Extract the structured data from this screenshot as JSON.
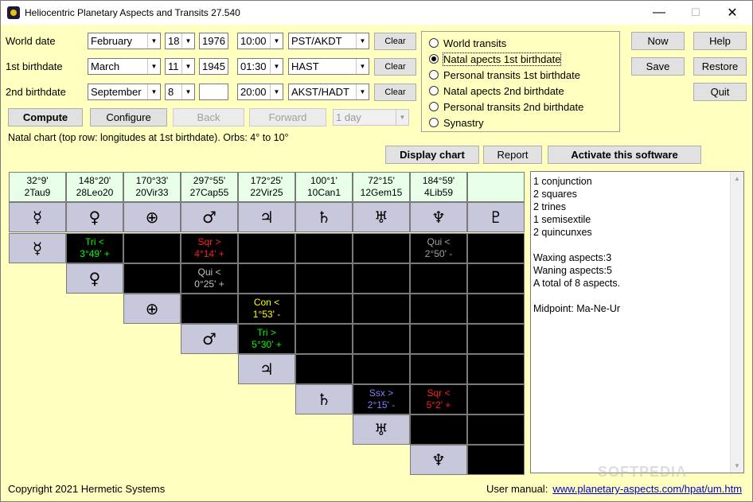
{
  "window": {
    "title": "Heliocentric Planetary Aspects and Transits 27.540"
  },
  "rows": [
    {
      "label": "World date",
      "month": "February",
      "day": "18",
      "year": "1976",
      "time": "10:00",
      "zone": "PST/AKDT",
      "clear": "Clear"
    },
    {
      "label": "1st birthdate",
      "month": "March",
      "day": "11",
      "year": "1945",
      "time": "01:30",
      "zone": "HAST",
      "clear": "Clear"
    },
    {
      "label": "2nd birthdate",
      "month": "September",
      "day": "8",
      "year": "",
      "time": "20:00",
      "zone": "AKST/HADT",
      "clear": "Clear"
    }
  ],
  "buttons": {
    "compute": "Compute",
    "configure": "Configure",
    "back": "Back",
    "forward": "Forward",
    "step": "1 day",
    "now": "Now",
    "help": "Help",
    "save": "Save",
    "restore": "Restore",
    "quit": "Quit",
    "display_chart": "Display chart",
    "report": "Report",
    "activate": "Activate this software"
  },
  "modes": [
    {
      "label": "World transits",
      "selected": false
    },
    {
      "label": "Natal apects 1st birthdate",
      "selected": true
    },
    {
      "label": "Personal transits 1st birthdate",
      "selected": false
    },
    {
      "label": "Natal apects 2nd birthdate",
      "selected": false
    },
    {
      "label": "Personal transits 2nd birthdate",
      "selected": false
    },
    {
      "label": "Synastry",
      "selected": false
    }
  ],
  "status": "Natal chart (top row: longitudes at 1st birthdate).  Orbs: 4° to 10°",
  "headers": [
    {
      "deg": "32°9'",
      "sign": "2Tau9"
    },
    {
      "deg": "148°20'",
      "sign": "28Leo20"
    },
    {
      "deg": "170°33'",
      "sign": "20Vir33"
    },
    {
      "deg": "297°55'",
      "sign": "27Cap55"
    },
    {
      "deg": "172°25'",
      "sign": "22Vir25"
    },
    {
      "deg": "100°1'",
      "sign": "10Can1"
    },
    {
      "deg": "72°15'",
      "sign": "12Gem15"
    },
    {
      "deg": "184°59'",
      "sign": "4Lib59"
    },
    {
      "deg": "",
      "sign": ""
    }
  ],
  "planets": [
    {
      "icon": "mercury-icon",
      "glyph": "☿"
    },
    {
      "icon": "venus-icon",
      "glyph": "♀"
    },
    {
      "icon": "earth-icon",
      "glyph": "⊕"
    },
    {
      "icon": "mars-icon",
      "glyph": "♂"
    },
    {
      "icon": "jupiter-icon",
      "glyph": "♃"
    },
    {
      "icon": "saturn-icon",
      "glyph": "♄"
    },
    {
      "icon": "uranus-icon",
      "glyph": "♅"
    },
    {
      "icon": "neptune-icon",
      "glyph": "♆"
    },
    {
      "icon": "pluto-icon",
      "glyph": "♇"
    }
  ],
  "aspects": [
    {
      "row": 0,
      "col": 1,
      "line1": "Tri <",
      "line2": "3°49' +",
      "color": "#00ff00"
    },
    {
      "row": 0,
      "col": 3,
      "line1": "Sqr >",
      "line2": "4°14' +",
      "color": "#ff2020"
    },
    {
      "row": 0,
      "col": 7,
      "line1": "Qui <",
      "line2": "2°50' -",
      "color": "#a0a0a0"
    },
    {
      "row": 1,
      "col": 3,
      "line1": "Qui <",
      "line2": "0°25' +",
      "color": "#c0c0c0"
    },
    {
      "row": 2,
      "col": 4,
      "line1": "Con <",
      "line2": "1°53' -",
      "color": "#ffff00"
    },
    {
      "row": 3,
      "col": 4,
      "line1": "Tri >",
      "line2": "5°30' +",
      "color": "#00ff00"
    },
    {
      "row": 5,
      "col": 6,
      "line1": "Ssx >",
      "line2": "2°15' -",
      "color": "#8080ff"
    },
    {
      "row": 5,
      "col": 7,
      "line1": "Sqr <",
      "line2": "5°2' +",
      "color": "#ff2020"
    }
  ],
  "summary": [
    "1 conjunction",
    "2 squares",
    "2 trines",
    "1 semisextile",
    "2 quincunxes",
    "",
    "Waxing aspects:3",
    "Waning aspects:5",
    "A total of 8 aspects.",
    "",
    "Midpoint: Ma-Ne-Ur"
  ],
  "watermark": "SOFTPEDIA",
  "footer": {
    "copyright": "Copyright 2021 Hermetic Systems",
    "manual_label": "User manual:",
    "manual_link": "www.planetary-aspects.com/hpat/um.htm"
  }
}
